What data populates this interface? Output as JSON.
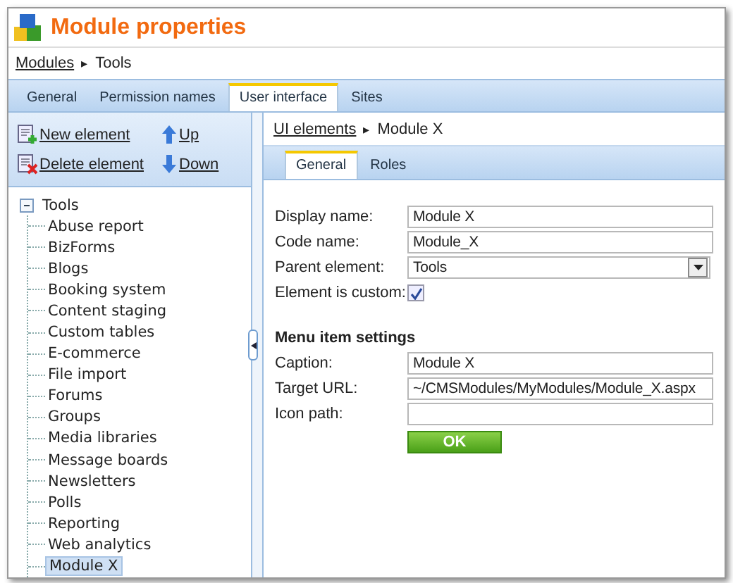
{
  "window": {
    "title": "Module properties"
  },
  "breadcrumb": {
    "link": "Modules",
    "separator": "▸",
    "current": "Tools"
  },
  "tabs": [
    {
      "label": "General",
      "selected": false
    },
    {
      "label": "Permission names",
      "selected": false
    },
    {
      "label": "User interface",
      "selected": true
    },
    {
      "label": "Sites",
      "selected": false
    }
  ],
  "toolbar": [
    {
      "label": "New element",
      "kind": "new"
    },
    {
      "label": "Up",
      "kind": "up"
    },
    {
      "label": "Delete element",
      "kind": "delete"
    },
    {
      "label": "Down",
      "kind": "down"
    }
  ],
  "tree": {
    "label": "Tools",
    "expanded": true,
    "children": [
      {
        "label": "Abuse report",
        "selected": false
      },
      {
        "label": "BizForms",
        "selected": false
      },
      {
        "label": "Blogs",
        "selected": false
      },
      {
        "label": "Booking system",
        "selected": false
      },
      {
        "label": "Content staging",
        "selected": false
      },
      {
        "label": "Custom tables",
        "selected": false
      },
      {
        "label": "E-commerce",
        "selected": false
      },
      {
        "label": "File import",
        "selected": false
      },
      {
        "label": "Forums",
        "selected": false
      },
      {
        "label": "Groups",
        "selected": false
      },
      {
        "label": "Media libraries",
        "selected": false
      },
      {
        "label": "Message boards",
        "selected": false
      },
      {
        "label": "Newsletters",
        "selected": false
      },
      {
        "label": "Polls",
        "selected": false
      },
      {
        "label": "Reporting",
        "selected": false
      },
      {
        "label": "Web analytics",
        "selected": false
      },
      {
        "label": "Module X",
        "selected": true
      }
    ]
  },
  "detail": {
    "breadcrumb": {
      "link": "UI elements",
      "separator": "▸",
      "current": "Module X"
    },
    "tabs": [
      {
        "label": "General",
        "selected": true
      },
      {
        "label": "Roles",
        "selected": false
      }
    ],
    "fields": [
      {
        "label": "Display name:",
        "kind": "text",
        "value": "Module X"
      },
      {
        "label": "Code name:",
        "kind": "text",
        "value": "Module_X"
      },
      {
        "label": "Parent element:",
        "kind": "select",
        "value": "Tools"
      },
      {
        "label": "Element is custom:",
        "kind": "checkbox",
        "checked": true
      }
    ],
    "section_title": "Menu item settings",
    "menu_fields": [
      {
        "label": "Caption:",
        "value": "Module X"
      },
      {
        "label": "Target URL:",
        "value": "~/CMSModules/MyModules/Module_X.aspx"
      },
      {
        "label": "Icon path:"
      }
    ],
    "ok_button": "OK"
  }
}
